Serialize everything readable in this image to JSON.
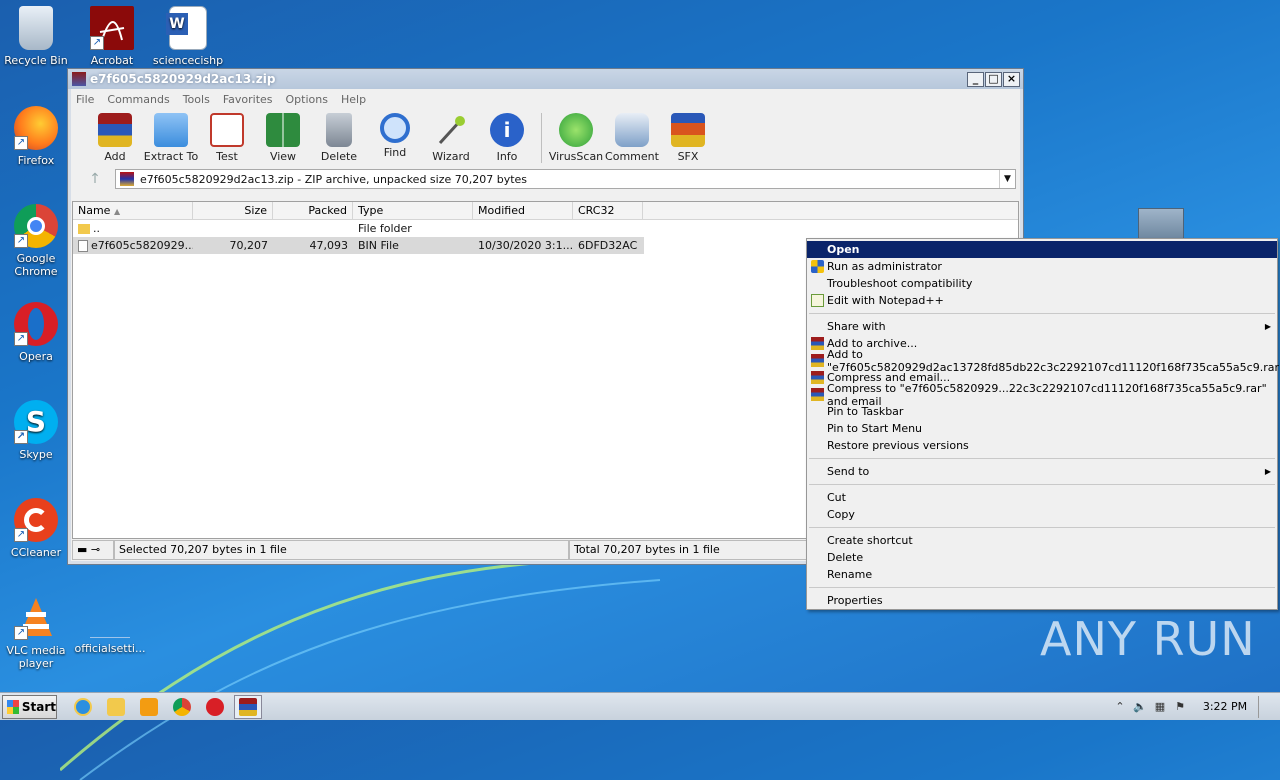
{
  "desktop": {
    "icons": [
      {
        "label": "Recycle Bin",
        "icon": "recycle-bin-icon"
      },
      {
        "label": "Acrobat",
        "icon": "acrobat-icon"
      },
      {
        "label": "sciencecishp",
        "icon": "word-document-icon"
      },
      {
        "label": "Firefox",
        "icon": "firefox-icon"
      },
      {
        "label": "Google Chrome",
        "icon": "chrome-icon"
      },
      {
        "label": "Opera",
        "icon": "opera-icon"
      },
      {
        "label": "Skype",
        "icon": "skype-icon"
      },
      {
        "label": "CCleaner",
        "icon": "ccleaner-icon"
      },
      {
        "label": "VLC media player",
        "icon": "vlc-icon"
      },
      {
        "label": "officialsetti...",
        "icon": "file-icon"
      }
    ]
  },
  "window": {
    "title": "e7f605c5820929d2ac13.zip",
    "controls": {
      "minimize": "_",
      "maximize": "□",
      "close": "×"
    },
    "menu": [
      "File",
      "Commands",
      "Tools",
      "Favorites",
      "Options",
      "Help"
    ],
    "toolbar": [
      {
        "label": "Add",
        "icon": "add-archive-icon",
        "color": "#b3242a"
      },
      {
        "label": "Extract To",
        "icon": "extract-folder-icon",
        "color": "#3b8ddd"
      },
      {
        "label": "Test",
        "icon": "test-checklist-icon",
        "color": "#c0392b"
      },
      {
        "label": "View",
        "icon": "view-book-icon",
        "color": "#2e8b3e"
      },
      {
        "label": "Delete",
        "icon": "trash-icon",
        "color": "#7d8794"
      },
      {
        "label": "Find",
        "icon": "magnifier-icon",
        "color": "#2f6fcf"
      },
      {
        "label": "Wizard",
        "icon": "wand-icon",
        "color": "#9acd32"
      },
      {
        "label": "Info",
        "icon": "info-icon",
        "color": "#2a62c9"
      },
      {
        "label": "VirusScan",
        "icon": "virus-scan-icon",
        "color": "#2fa13b"
      },
      {
        "label": "Comment",
        "icon": "comment-icon",
        "color": "#7ea0c8"
      },
      {
        "label": "SFX",
        "icon": "sfx-box-icon",
        "color": "#d9541e"
      }
    ],
    "address": "e7f605c5820929d2ac13.zip - ZIP archive, unpacked size 70,207 bytes",
    "columns": [
      "Name",
      "Size",
      "Packed",
      "Type",
      "Modified",
      "CRC32"
    ],
    "rows": [
      {
        "name": "..",
        "size": "",
        "packed": "",
        "type": "File folder",
        "modified": "",
        "crc": ""
      },
      {
        "name": "e7f605c5820929...",
        "size": "70,207",
        "packed": "47,093",
        "type": "BIN File",
        "modified": "10/30/2020 3:1...",
        "crc": "6DFD32AC"
      }
    ],
    "status_left": "Selected 70,207 bytes in 1 file",
    "status_right": "Total 70,207 bytes in 1 file"
  },
  "context_menu": {
    "open": "Open",
    "run_admin": "Run as administrator",
    "troubleshoot": "Troubleshoot compatibility",
    "edit_notepad": "Edit with Notepad++",
    "share_with": "Share with",
    "add_archive": "Add to archive...",
    "add_to_rar": "Add to \"e7f605c5820929d2ac13728fd85db22c3c2292107cd11120f168f735ca55a5c9.rar\"",
    "compress_email": "Compress and email...",
    "compress_to_email": "Compress to \"e7f605c5820929...22c3c2292107cd11120f168f735ca55a5c9.rar\" and email",
    "pin_taskbar": "Pin to Taskbar",
    "pin_start": "Pin to Start Menu",
    "restore": "Restore previous versions",
    "send_to": "Send to",
    "cut": "Cut",
    "copy": "Copy",
    "create_shortcut": "Create shortcut",
    "delete": "Delete",
    "rename": "Rename",
    "properties": "Properties"
  },
  "watermark": "ANY RUN",
  "taskbar": {
    "start": "Start",
    "apps": [
      "internet-explorer-icon",
      "explorer-folder-icon",
      "media-player-icon",
      "chrome-icon",
      "opera-icon",
      "winrar-icon"
    ],
    "clock": "3:22 PM"
  }
}
